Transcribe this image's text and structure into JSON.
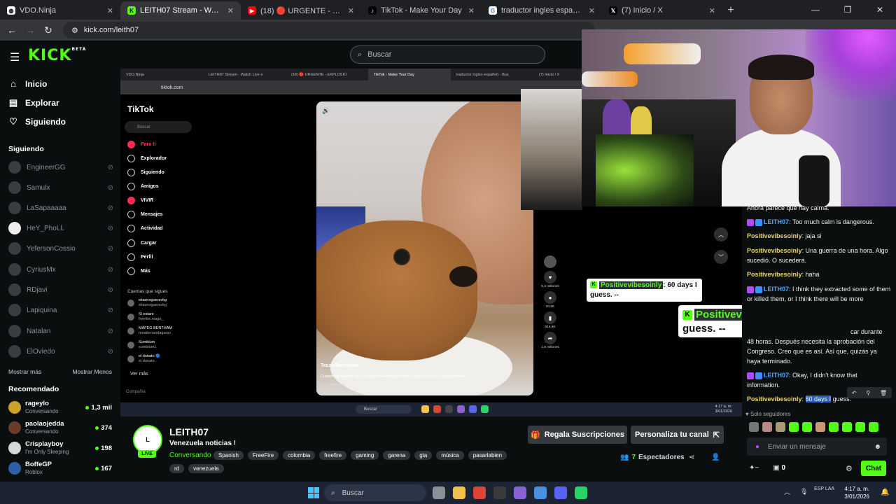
{
  "browser": {
    "tabs": [
      {
        "title": "VDO.Ninja",
        "icon": "globe-icon",
        "active": false
      },
      {
        "title": "LEITH07 Stream - Watch Live on",
        "icon": "kick-icon",
        "active": true
      },
      {
        "title": "(18) 🔴 URGENTE - EXPLOSION",
        "icon": "youtube-icon",
        "active": false
      },
      {
        "title": "TikTok - Make Your Day",
        "icon": "tiktok-icon",
        "active": false
      },
      {
        "title": "traductor ingles español) - Busc",
        "icon": "google-icon",
        "active": false
      },
      {
        "title": "(7) Inicio / X",
        "icon": "x-icon",
        "active": false
      }
    ],
    "url": "kick.com/leith07"
  },
  "kick": {
    "search_placeholder": "Buscar",
    "nav": [
      "Inicio",
      "Explorar",
      "Siguiendo"
    ],
    "following_header": "Siguiendo",
    "following": [
      "EngineerGG",
      "Samulx",
      "LaSapaaaaa",
      "HeY_PhoLL",
      "YefersonCossio",
      "CyriusMx",
      "RDjavi",
      "Lapiquina",
      "Natalan",
      "ElOviedo"
    ],
    "show_more": "Mostrar más",
    "show_less": "Mostrar Menos",
    "recommended_header": "Recomendado",
    "recommended": [
      {
        "name": "rageylo",
        "category": "Conversando",
        "viewers": "1,3 mil",
        "avatar": "#c9a227"
      },
      {
        "name": "paolaojedda",
        "category": "Conversando",
        "viewers": "374",
        "avatar": "#6b3b2a"
      },
      {
        "name": "Crisplayboy",
        "category": "I'm Only Sleeping",
        "viewers": "198",
        "avatar": "#d9d9d9"
      },
      {
        "name": "BoffeGP",
        "category": "Roblox",
        "viewers": "167",
        "avatar": "#2d5fa8"
      }
    ]
  },
  "stream_screen": {
    "tabs": [
      "VDO.Ninja",
      "LEITH07 Stream - Watch Live o",
      "(18) 🔴 URGENTE - EXPLOSIÓ",
      "TikTok - Make Your Day",
      "traductor ingles español) - Bus",
      "(7) Inicio / X"
    ],
    "url": "tiktok.com",
    "tiktok": {
      "logo": "TikTok",
      "search": "Buscar",
      "nav": [
        "Para ti",
        "Explorador",
        "Siguiendo",
        "Amigos",
        "VIVIR",
        "Mensajes",
        "Actividad",
        "Cargar",
        "Perfil",
        "Más"
      ],
      "following_header": "Cuentas que sigues",
      "following": [
        {
          "name": "eliasnogueravkg",
          "sub": "eliasnogueravkg"
        },
        {
          "name": "Si estare",
          "sub": "freefire.mago_"
        },
        {
          "name": "MAFEG BENTHAM",
          "sub": "mriafernandagarav"
        },
        {
          "name": "Sumblum",
          "sub": "sumblum1"
        },
        {
          "name": "el donato 🔵",
          "sub": "el donato"
        }
      ],
      "see_more": "Ver más",
      "company": "Compañía",
      "video_user": "Tessa Bermúdez",
      "video_caption": "Cuando de repente beso a mi perro#videosdivertidos #perros #para ti #perrosoftiktok ...",
      "video_translate": "Ver traducción",
      "actions": [
        {
          "icon": "heart-icon",
          "count": "5,4 millones"
        },
        {
          "icon": "comment-icon",
          "count": "20,6K"
        },
        {
          "icon": "bookmark-icon",
          "count": "616,6K"
        },
        {
          "icon": "share-icon",
          "count": "1,5 millones"
        }
      ]
    },
    "taskbar_search": "Buscar",
    "clock_time": "4:17 a. m.",
    "clock_date": "3/01/2026",
    "lang": "ESP LAA"
  },
  "overlay": {
    "user": "Positivevibesoinly",
    "text": ": 60 days I guess. --"
  },
  "stream": {
    "avatar_text": "L",
    "live": "LIVE",
    "name": "LEITH07",
    "title": "Venezuela noticias !",
    "category": "Conversando",
    "tags": [
      "Spanish",
      "FreeFire",
      "colombia",
      "freefire",
      "gaming",
      "garena",
      "gta",
      "música",
      "pasarlabien"
    ],
    "tags2": [
      "rd",
      "venezuela"
    ],
    "gift_button": "Regala Suscripciones",
    "customize_button": "Personaliza tu canal",
    "viewers": "7",
    "viewers_label": "Espectadores"
  },
  "chat": {
    "messages": [
      {
        "user": "",
        "text": "Ahora parece que hay calma."
      },
      {
        "user": "LEITH07",
        "text": ": Too much calm is dangerous.",
        "badges": true
      },
      {
        "user": "Positivevibesoinly",
        "text": ": jaja si"
      },
      {
        "user": "Positivevibesoinly",
        "text": ": Una guerra de una hora. Algo sucedió. O sucederá."
      },
      {
        "user": "Positivevibesoinly",
        "text": ": haha"
      },
      {
        "user": "LEITH07",
        "text": ": I think they extracted some of them or killed them, or I think there will be more",
        "badges": true
      },
      {
        "user": "",
        "text": "car durante 48 horas. Después necesita la aprobación del Congreso. Creo que es así. Así que, quizás ya haya terminado."
      },
      {
        "user": "LEITH07",
        "text": ": Okay, I didn't know that information.",
        "badges": true
      },
      {
        "user": "Positivevibesoinly",
        "text": ": ",
        "highlight": "60 days I",
        "rest": " guess."
      }
    ],
    "followers_only": "Solo seguidores",
    "input_placeholder": "Enviar un mensaje",
    "points": "0",
    "chat_button": "Chat"
  },
  "taskbar": {
    "search": "Buscar",
    "lang": "ESP LAA",
    "time": "4:17 a. m.",
    "date": "3/01/2026"
  }
}
